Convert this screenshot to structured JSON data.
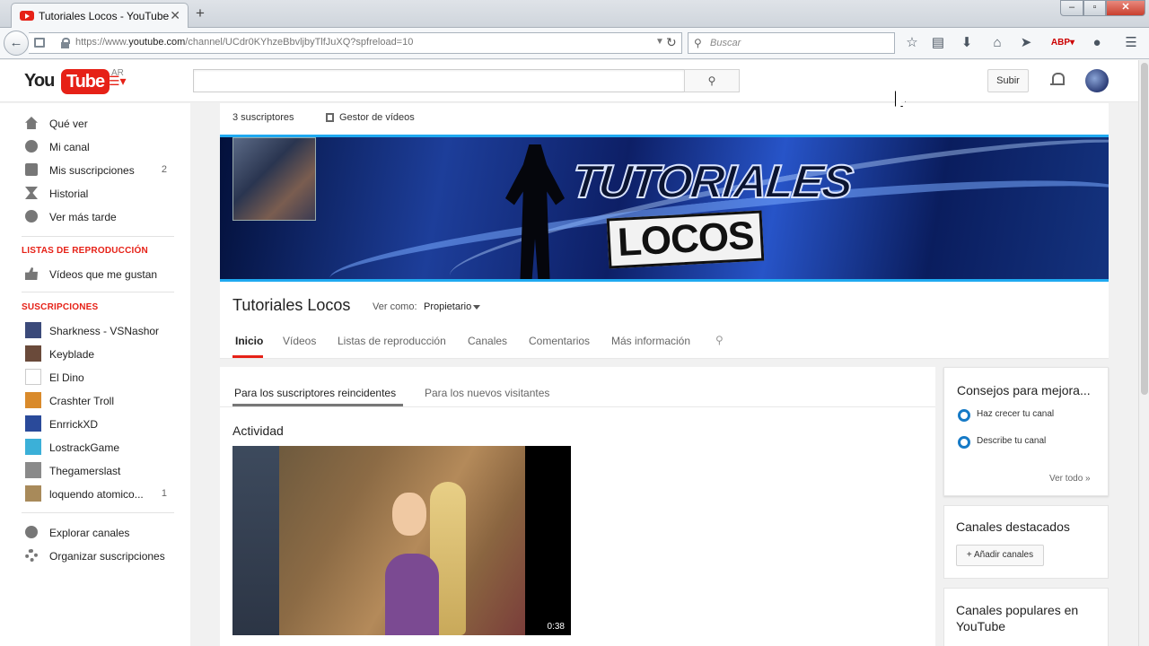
{
  "browser": {
    "tab_title": "Tutoriales Locos - YouTube",
    "tab_close": "✕",
    "new_tab": "+",
    "url_prefix": "https://www.",
    "url_host": "youtube.com",
    "url_path": "/channel/UCdr0KYhzeBbvljbyTlfJuXQ?spfreload=10",
    "search_placeholder": "Buscar",
    "window_buttons": [
      "–",
      "▫",
      "✕"
    ]
  },
  "masthead": {
    "logo_you": "You",
    "logo_tube": "Tube",
    "region": "AR",
    "upload_label": "Subir"
  },
  "sidebar": {
    "main_items": [
      {
        "label": "Qué ver",
        "icon": "home-icon"
      },
      {
        "label": "Mi canal",
        "icon": "user-icon"
      },
      {
        "label": "Mis suscripciones",
        "icon": "subscriptions-icon",
        "count": "2"
      },
      {
        "label": "Historial",
        "icon": "history-icon"
      },
      {
        "label": "Ver más tarde",
        "icon": "clock-icon"
      }
    ],
    "playlists_heading": "LISTAS DE REPRODUCCIÓN",
    "liked_videos": "Vídeos que me gustan",
    "subscriptions_heading": "SUSCRIPCIONES",
    "subscriptions": [
      {
        "label": "Sharkness - VSNashor",
        "color": "#3b4a7a"
      },
      {
        "label": "Keyblade",
        "color": "#6a4a3a"
      },
      {
        "label": "El Dino",
        "color": "#ffffff"
      },
      {
        "label": "Crashter Troll",
        "color": "#d98a2b"
      },
      {
        "label": "EnrrickXD",
        "color": "#2a4a9a"
      },
      {
        "label": "LostrackGame",
        "color": "#3bb0d8"
      },
      {
        "label": "Thegamerslast",
        "color": "#8a8a8a"
      },
      {
        "label": "loquendo atomico...",
        "color": "#a88a5a",
        "count": "1"
      }
    ],
    "explore": "Explorar canales",
    "manage": "Organizar suscripciones"
  },
  "channel": {
    "subscribers": "3 suscriptores",
    "video_manager": "Gestor de vídeos",
    "banner_line1": "TUTORIALES",
    "banner_line2": "LOCOS",
    "name": "Tutoriales Locos",
    "view_as_label": "Ver como:",
    "view_as_value": "Propietario",
    "tabs": [
      "Inicio",
      "Vídeos",
      "Listas de reproducción",
      "Canales",
      "Comentarios",
      "Más información"
    ]
  },
  "feed": {
    "tabs": [
      "Para los suscriptores reincidentes",
      "Para los nuevos visitantes"
    ],
    "activity_title": "Actividad",
    "video_duration": "0:38"
  },
  "tips": {
    "title": "Consejos para mejora...",
    "items": [
      "Haz crecer tu canal",
      "Describe tu canal"
    ],
    "see_all": "Ver todo »"
  },
  "featured": {
    "title": "Canales destacados",
    "add_button": "+ Añadir canales"
  },
  "popular": {
    "title": "Canales populares en YouTube"
  },
  "colors": {
    "brand_red": "#e62117",
    "link_blue": "#167ac6"
  }
}
